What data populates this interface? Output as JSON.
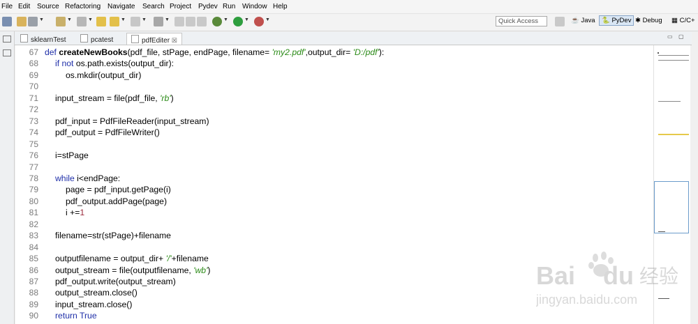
{
  "menu": [
    "File",
    "Edit",
    "Source",
    "Refactoring",
    "Navigate",
    "Search",
    "Project",
    "Pydev",
    "Run",
    "Window",
    "Help"
  ],
  "quick_access": "Quick Access",
  "perspectives": {
    "java": "Java",
    "pydev": "PyDev",
    "debug": "Debug",
    "cpp": "C/C+"
  },
  "tabs": [
    {
      "label": "sklearnTest",
      "active": false
    },
    {
      "label": "pcatest",
      "active": false
    },
    {
      "label": "pdfEditer",
      "active": true,
      "close": "☒"
    }
  ],
  "code": [
    {
      "n": "67",
      "html_segments": [
        [
          "kw",
          "def "
        ],
        [
          "fn",
          "createNewBooks"
        ],
        [
          "",
          "(pdf_file, stPage, endPage, filename= "
        ],
        [
          "str",
          "'my2.pdf'"
        ],
        [
          "",
          ",output_dir= "
        ],
        [
          "str",
          "'D:/pdf'"
        ],
        [
          "",
          "):"
        ]
      ],
      "indent": 0
    },
    {
      "n": "68",
      "html_segments": [
        [
          "kw",
          "if not "
        ],
        [
          "",
          "os.path.exists(output_dir):"
        ]
      ],
      "indent": 1
    },
    {
      "n": "69",
      "html_segments": [
        [
          "",
          "os.mkdir(output_dir)"
        ]
      ],
      "indent": 2
    },
    {
      "n": "70",
      "html_segments": [],
      "indent": 0
    },
    {
      "n": "71",
      "html_segments": [
        [
          "",
          "input_stream = file(pdf_file, "
        ],
        [
          "str",
          "'rb'"
        ],
        [
          "",
          ")"
        ]
      ],
      "indent": 1
    },
    {
      "n": "72",
      "html_segments": [],
      "indent": 0
    },
    {
      "n": "73",
      "html_segments": [
        [
          "",
          "pdf_input = PdfFileReader(input_stream)"
        ]
      ],
      "indent": 1
    },
    {
      "n": "74",
      "html_segments": [
        [
          "",
          "pdf_output = PdfFileWriter()"
        ]
      ],
      "indent": 1
    },
    {
      "n": "75",
      "html_segments": [],
      "indent": 0
    },
    {
      "n": "76",
      "html_segments": [
        [
          "",
          "i=stPage"
        ]
      ],
      "indent": 1
    },
    {
      "n": "77",
      "html_segments": [],
      "indent": 0
    },
    {
      "n": "78",
      "html_segments": [
        [
          "kw",
          "while "
        ],
        [
          "",
          "i<endPage:"
        ]
      ],
      "indent": 1
    },
    {
      "n": "79",
      "html_segments": [
        [
          "",
          "page = pdf_input.getPage(i)"
        ]
      ],
      "indent": 2
    },
    {
      "n": "80",
      "html_segments": [
        [
          "",
          "pdf_output.addPage(page)"
        ]
      ],
      "indent": 2
    },
    {
      "n": "81",
      "html_segments": [
        [
          "",
          "i +="
        ],
        [
          "num",
          "1"
        ]
      ],
      "indent": 2
    },
    {
      "n": "82",
      "html_segments": [],
      "indent": 0
    },
    {
      "n": "83",
      "html_segments": [
        [
          "",
          "filename=str(stPage)+filename"
        ]
      ],
      "indent": 1
    },
    {
      "n": "84",
      "html_segments": [],
      "indent": 0
    },
    {
      "n": "85",
      "html_segments": [
        [
          "",
          "outputfilename = output_dir+ "
        ],
        [
          "str",
          "'/'"
        ],
        [
          "",
          "+filename"
        ]
      ],
      "indent": 1
    },
    {
      "n": "86",
      "html_segments": [
        [
          "",
          "output_stream = file(outputfilename, "
        ],
        [
          "str",
          "'wb'"
        ],
        [
          "",
          ")"
        ]
      ],
      "indent": 1
    },
    {
      "n": "87",
      "html_segments": [
        [
          "",
          "pdf_output.write(output_stream)"
        ]
      ],
      "indent": 1
    },
    {
      "n": "88",
      "html_segments": [
        [
          "",
          "output_stream.close()"
        ]
      ],
      "indent": 1
    },
    {
      "n": "89",
      "html_segments": [
        [
          "",
          "input_stream.close()"
        ]
      ],
      "indent": 1
    },
    {
      "n": "90",
      "html_segments": [
        [
          "kw",
          "return True"
        ]
      ],
      "indent": 1
    }
  ],
  "watermark": {
    "brand": "Bai",
    "brand2": "du",
    "cn": "经验",
    "url": "jingyan.baidu.com"
  }
}
